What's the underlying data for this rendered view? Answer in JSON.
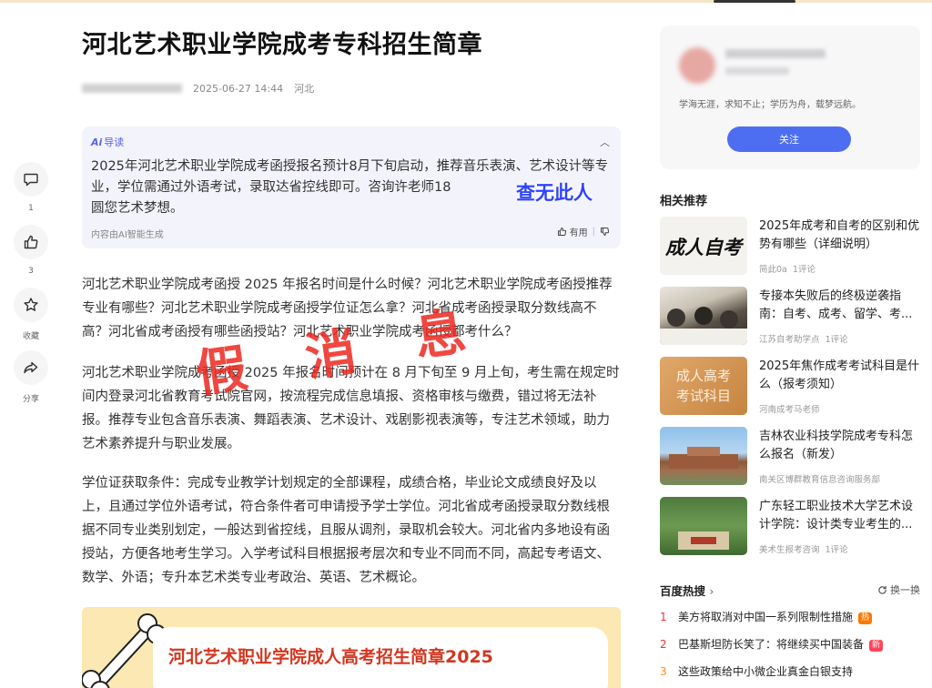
{
  "article": {
    "title": "河北艺术职业学院成考专科招生简章",
    "date": "2025-06-27 14:44",
    "location": "河北"
  },
  "actions": [
    {
      "icon": "comment-icon",
      "label": "1"
    },
    {
      "icon": "thumbs-up-icon",
      "label": "3"
    },
    {
      "icon": "star-icon",
      "label": "收藏"
    },
    {
      "icon": "share-icon",
      "label": "分享"
    }
  ],
  "ai_summary": {
    "label": "导读",
    "text": "2025年河北艺术职业学院成考函授报名预计8月下旬启动，推荐音乐表演、艺术设计等专业，学位需通过外语考试，录取达省控线即可。咨询许老师18",
    "text_end": "圆您艺术梦想。",
    "footer": "内容由AI智能生成",
    "useful_label": "有用",
    "overlay_text": "查无此人"
  },
  "overlay_stamp": [
    "假",
    "消",
    "息"
  ],
  "paragraphs": [
    "河北艺术职业学院成考函授 2025 年报名时间是什么时候？河北艺术职业学院成考函授推荐专业有哪些？河北艺术职业学院成考函授学位证怎么拿？河北省成考函授录取分数线高不高？河北省成考函授有哪些函授站？河北艺术职业学院成考函授都考什么？",
    "河北艺术职业学院成考函授 2025 年报名时间预计在 8 月下旬至 9 月上旬，考生需在规定时间内登录河北省教育考试院官网，按流程完成信息填报、资格审核与缴费，错过将无法补报。推荐专业包含音乐表演、舞蹈表演、艺术设计、戏剧影视表演等，专注艺术领域，助力艺术素养提升与职业发展。",
    "学位证获取条件：完成专业教学计划规定的全部课程，成绩合格，毕业论文成绩良好及以上，且通过学位外语考试，符合条件者可申请授予学士学位。河北省成考函授录取分数线根据不同专业类别划定，一般达到省控线，且服从调剂，录取机会较大。河北省内多地设有函授站，方便各地考生学习。入学考试科目根据报考层次和专业不同而不同，高起专考语文、数学、外语；专升本艺术类专业考政治、英语、艺术概论。"
  ],
  "banner": {
    "title": "河北艺术职业学院成人高考招生简章2025"
  },
  "author_card": {
    "motto": "学海无涯，求知不止；学历为舟，载梦远航。",
    "follow_label": "关注"
  },
  "related": {
    "title": "相关推荐",
    "items": [
      {
        "title": "2025年成考和自考的区别和优势有哪些（详细说明）",
        "source": "简此0a",
        "comments": "1评论",
        "thumb_text": "成人自考"
      },
      {
        "title": "专接本失败后的终极逆袭指南：自考、成考、留学、考...",
        "source": "江苏自考助学点",
        "comments": "1评论",
        "thumb_text": ""
      },
      {
        "title": "2025年焦作成考考试科目是什么（报考须知）",
        "source": "河南成考马老师",
        "comments": "",
        "thumb_text": "成人高考考试科目"
      },
      {
        "title": "吉林农业科技学院成考专科怎么报名（新发）",
        "source": "南关区博群教育信息咨询服务部",
        "comments": "",
        "thumb_text": ""
      },
      {
        "title": "广东轻工职业技术大学艺术设计学院：设计类专业考生的...",
        "source": "美术生报考咨询",
        "comments": "1评论",
        "thumb_text": ""
      }
    ]
  },
  "hot": {
    "title": "百度热搜",
    "refresh_label": "换一换",
    "items": [
      {
        "rank": "1",
        "text": "美方将取消对中国一系列限制性措施",
        "tag": "热",
        "tag_color": "#ff7700"
      },
      {
        "rank": "2",
        "text": "巴基斯坦防长笑了：将继续买中国装备",
        "tag": "新",
        "tag_color": "#ff455b"
      },
      {
        "rank": "3",
        "text": "这些政策给中小微企业真金白银支持",
        "tag": "",
        "tag_color": ""
      }
    ]
  },
  "colors": {
    "accent": "#4e6ef2",
    "stamp_red": "#ec2820",
    "stamp_blue": "#2f43ff",
    "hot_red": "#f73131"
  }
}
